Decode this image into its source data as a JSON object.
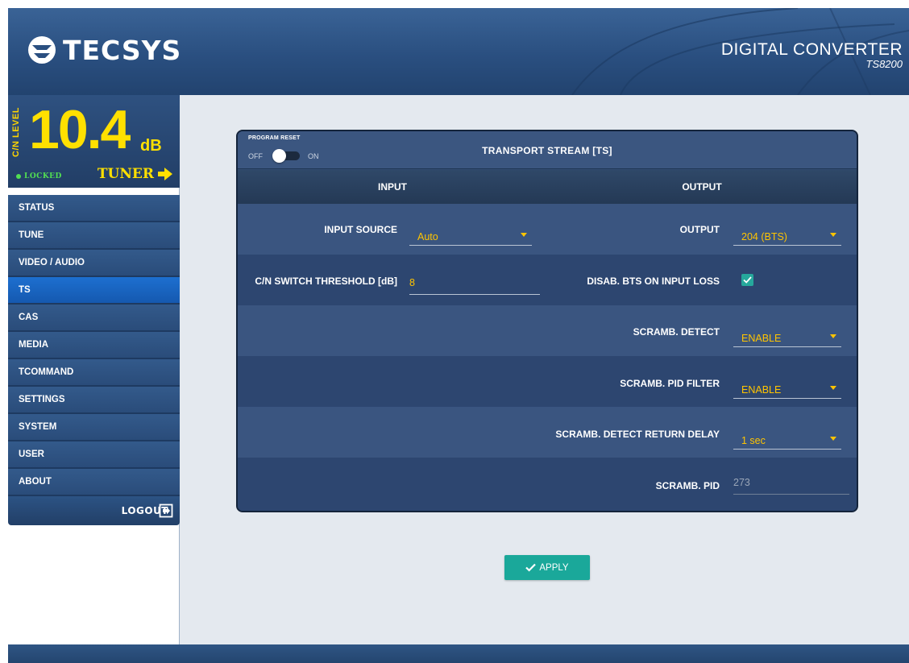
{
  "header": {
    "logo_text": "TECSYS",
    "product_name": "DIGITAL CONVERTER",
    "product_model": "TS8200"
  },
  "level": {
    "label": "C/N LEVEL",
    "value": "10.4",
    "unit": "dB",
    "status": "LOCKED",
    "tuner_label": "TUNER"
  },
  "sidebar": {
    "items": [
      {
        "label": "STATUS",
        "active": false
      },
      {
        "label": "TUNE",
        "active": false
      },
      {
        "label": "VIDEO / AUDIO",
        "active": false
      },
      {
        "label": "TS",
        "active": true
      },
      {
        "label": "CAS",
        "active": false
      },
      {
        "label": "MEDIA",
        "active": false
      },
      {
        "label": "TCOMMAND",
        "active": false
      },
      {
        "label": "SETTINGS",
        "active": false
      },
      {
        "label": "SYSTEM",
        "active": false
      },
      {
        "label": "USER",
        "active": false
      },
      {
        "label": "ABOUT",
        "active": false
      }
    ],
    "logout_label": "LOGOUT"
  },
  "panel": {
    "program_reset_label": "PROGRAM RESET",
    "toggle_off": "OFF",
    "toggle_on": "ON",
    "title": "TRANSPORT STREAM [TS]",
    "input_header": "INPUT",
    "output_header": "OUTPUT",
    "input_source_label": "INPUT SOURCE",
    "input_source_value": "Auto",
    "cn_threshold_label": "C/N SWITCH THRESHOLD [dB]",
    "cn_threshold_value": "8",
    "output_label": "OUTPUT",
    "output_value": "204 (BTS)",
    "disab_bts_label": "DISAB. BTS ON INPUT LOSS",
    "disab_bts_checked": true,
    "scramb_detect_label": "SCRAMB. DETECT",
    "scramb_detect_value": "ENABLE",
    "scramb_pid_filter_label": "SCRAMB. PID FILTER",
    "scramb_pid_filter_value": "ENABLE",
    "scramb_return_delay_label": "SCRAMB. DETECT RETURN DELAY",
    "scramb_return_delay_value": "1 sec",
    "scramb_pid_label": "SCRAMB. PID",
    "scramb_pid_value": "273"
  },
  "apply_label": "APPLY",
  "colors": {
    "accent_yellow": "#ffe000",
    "value_amber": "#ffc400",
    "locked_green": "#52e052",
    "active_blue": "#1d6fd0",
    "apply_teal": "#1aa89a"
  }
}
